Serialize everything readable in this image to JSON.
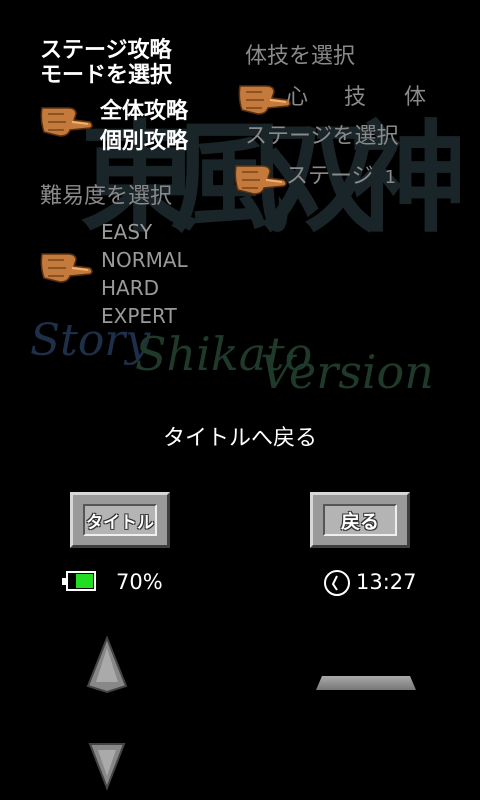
{
  "mode_select": {
    "title_line1": "ステージ攻略",
    "title_line2": "モードを選択",
    "options": [
      "全体攻略",
      "個別攻略"
    ]
  },
  "skill_select": {
    "title": "体技を選択",
    "options": [
      "心",
      "技",
      "体"
    ]
  },
  "stage_select": {
    "title": "ステージを選択",
    "current": "ステージ",
    "number": "1"
  },
  "difficulty_select": {
    "title": "難易度を選択",
    "options": [
      "EASY",
      "NORMAL",
      "HARD",
      "EXPERT"
    ]
  },
  "watermark": {
    "kanji": "東風双神",
    "line1": "Story",
    "line2": "Shikato",
    "line3": "Version"
  },
  "back_to_title": "タイトルへ戻る",
  "buttons": {
    "title_label": "タイトル",
    "back_label": "戻る"
  },
  "status": {
    "battery": "70%",
    "battery_level": 0.7,
    "time": "13:27"
  },
  "colors": {
    "battery_fill": "#22dd22",
    "button_face": "#9a9a9a",
    "dim_text": "#8a8a8a"
  }
}
